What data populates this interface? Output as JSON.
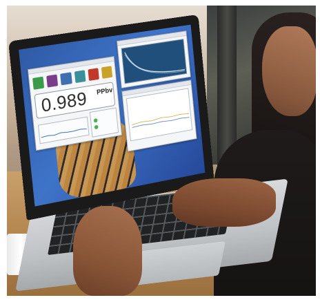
{
  "screen": {
    "reading_value": "0.989",
    "reading_unit": "PPbv"
  },
  "colors": {
    "desktop_blue": "#3e74c8",
    "graph_panel": "#1f4f7a",
    "icon_green": "#3a9a4a",
    "icon_purple": "#7a3d8c",
    "icon_blue": "#3f6fb0",
    "icon_teal": "#3b8f9a",
    "icon_red": "#c0392b",
    "icon_yellow": "#c9a227",
    "status_led": "#4caf50"
  },
  "icons": [
    "app-green-icon",
    "app-purple-icon",
    "app-blue-icon",
    "app-teal-icon",
    "app-red-icon",
    "app-yellow-icon"
  ]
}
